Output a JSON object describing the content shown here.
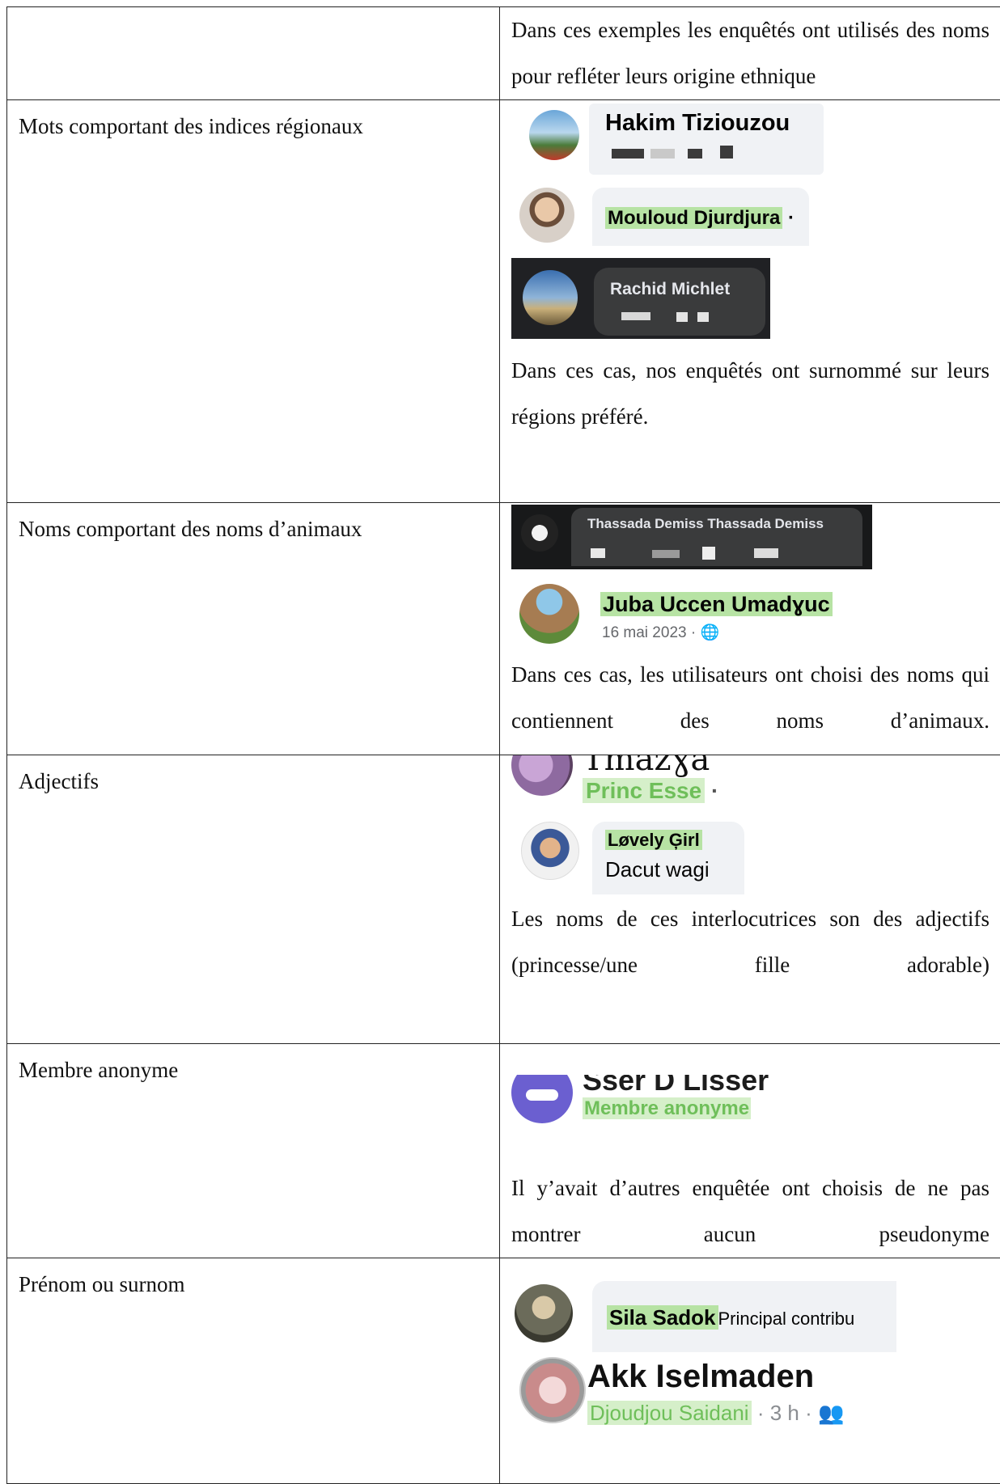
{
  "rows": [
    {
      "label": "",
      "text": "Dans ces exemples les enquêtés ont utilisés des noms pour refléter leurs origine ethnique"
    },
    {
      "label": "Mots comportant des indices régionaux",
      "profiles": [
        "Hakim Tiziouzou",
        "Mouloud Djurdjura",
        "Rachid Michlet"
      ],
      "text": "Dans ces cas, nos enquêtés ont surnommé sur leurs régions préféré."
    },
    {
      "label": "Noms comportant des noms d’animaux",
      "profiles": [
        "Thassada Demiss Thassada Demiss",
        "Juba Uccen Umadɣuc"
      ],
      "meta": "16 mai 2023 ·",
      "text": "Dans ces cas, les utilisateurs ont choisi des noms qui contiennent des noms d’animaux."
    },
    {
      "label": "Adjectifs",
      "profiles": [
        "Tmazɣa",
        "Princ Esse",
        "Løvely Ģirl"
      ],
      "comment": "Dacut wagi",
      "text": "Les noms de ces interlocutrices son des adjectifs (princesse/une fille adorable)"
    },
    {
      "label": "Membre anonyme",
      "profiles": [
        "Sser D Lisser",
        "Membre anonyme"
      ],
      "text": "Il y’avait d’autres enquêtée ont choisis de ne pas montrer aucun pseudonyme"
    },
    {
      "label": "Prénom ou surnom",
      "profiles": [
        "Sila Sadok",
        "Akk Iselmaden",
        "Djoudjou Saidani"
      ],
      "badge": "Principal contribu",
      "meta": "· 3 h ·"
    }
  ]
}
